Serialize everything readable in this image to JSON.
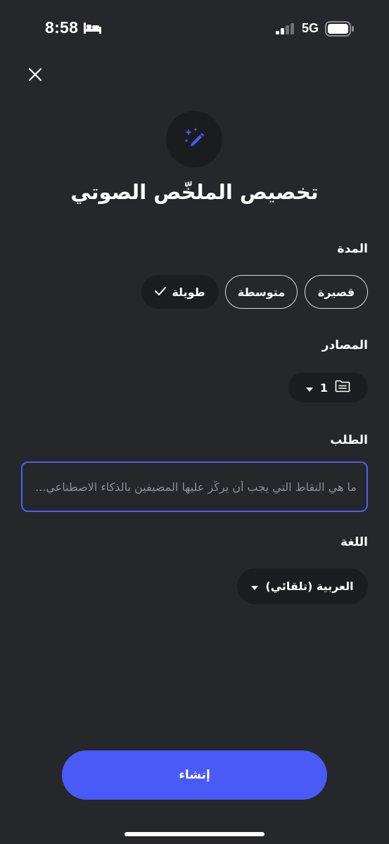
{
  "status_bar": {
    "time": "8:58",
    "network": "5G",
    "icons": [
      "bed-icon",
      "signal-icon",
      "battery-icon"
    ]
  },
  "header": {
    "close_icon": "close-icon",
    "hero_icon": "magic-pen-icon",
    "title": "تخصيص الملخّص الصوتي"
  },
  "duration": {
    "label": "المدة",
    "options": [
      "قصيرة",
      "متوسطة",
      "طويلة"
    ],
    "selected": "طويلة"
  },
  "sources": {
    "label": "المصادر",
    "count": "1",
    "icons": [
      "folder-icon",
      "caret-down-icon"
    ]
  },
  "prompt": {
    "label": "الطلب",
    "placeholder": "ما هي النقاط التي يجب أن يركِّز عليها المضيفين بالذكاء الاصطناعي..."
  },
  "language": {
    "label": "اللغة",
    "value": "العربية (تلقائي)"
  },
  "actions": {
    "create_label": "إنشاء"
  },
  "colors": {
    "background": "#25272b",
    "accent": "#4a5af7",
    "input_border": "#4d5ff0",
    "chip_fill": "#1b1d20"
  }
}
